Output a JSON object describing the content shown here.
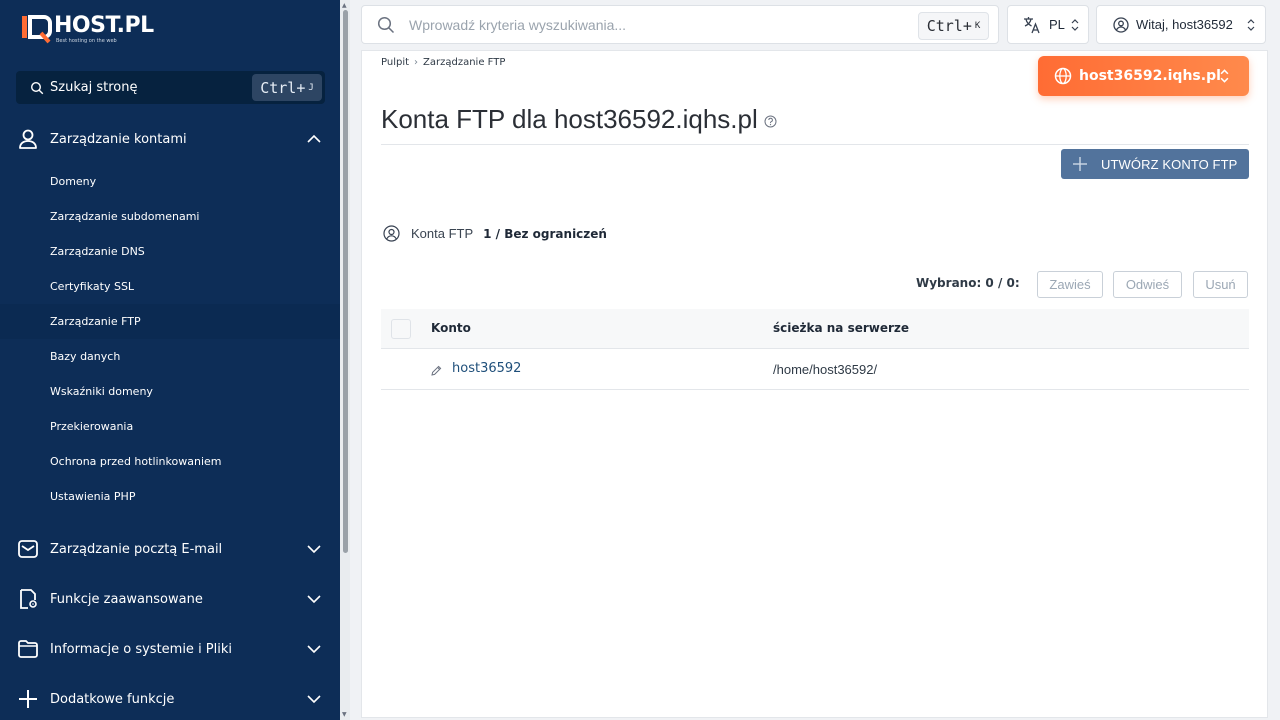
{
  "brand": {
    "name": "HOST.PL",
    "tagline": "Best hosting on the web",
    "accent": "#ff6c34",
    "sidebar_bg": "#0d2d57"
  },
  "sidebar": {
    "search": {
      "label": "Szukaj stronę",
      "shortcut_prefix": "Ctrl+",
      "shortcut_key": "J"
    },
    "sections": [
      {
        "title": "Zarządzanie kontami",
        "icon": "user-icon",
        "expanded": true
      },
      {
        "title": "Zarządzanie pocztą E-mail",
        "icon": "mail-icon",
        "expanded": false
      },
      {
        "title": "Funkcje zaawansowane",
        "icon": "document-gear-icon",
        "expanded": false
      },
      {
        "title": "Informacje o systemie i Pliki",
        "icon": "folder-icon",
        "expanded": false
      },
      {
        "title": "Dodatkowe funkcje",
        "icon": "plus-icon",
        "expanded": false
      }
    ],
    "items": [
      {
        "label": "Domeny"
      },
      {
        "label": "Zarządzanie subdomenami"
      },
      {
        "label": "Zarządzanie DNS"
      },
      {
        "label": "Certyfikaty SSL"
      },
      {
        "label": "Zarządzanie FTP",
        "active": true
      },
      {
        "label": "Bazy danych"
      },
      {
        "label": "Wskaźniki domeny"
      },
      {
        "label": "Przekierowania"
      },
      {
        "label": "Ochrona przed hotlinkowaniem"
      },
      {
        "label": "Ustawienia PHP"
      }
    ]
  },
  "topbar": {
    "search": {
      "placeholder": "Wprowadź kryteria wyszukiwania...",
      "shortcut_prefix": "Ctrl+",
      "shortcut_key": "K"
    },
    "language": "PL",
    "user_greeting": "Witaj, host36592"
  },
  "main": {
    "breadcrumb": [
      "Pulpit",
      "Zarządzanie FTP"
    ],
    "domain_selector": "host36592.iqhs.pl",
    "title": "Konta FTP dla host36592.iqhs.pl",
    "create_button": "UTWÓRZ KONTO FTP",
    "quota": {
      "label": "Konta FTP",
      "value": "1 / Bez ograniczeń"
    },
    "selection": {
      "text": "Wybrano: 0 / 0:"
    },
    "bulk_actions": [
      "Zawieś",
      "Odwieś",
      "Usuń"
    ],
    "table": {
      "columns": [
        "Konto",
        "ścieżka na serwerze"
      ],
      "rows": [
        {
          "account": "host36592",
          "path": "/home/host36592/"
        }
      ]
    }
  }
}
